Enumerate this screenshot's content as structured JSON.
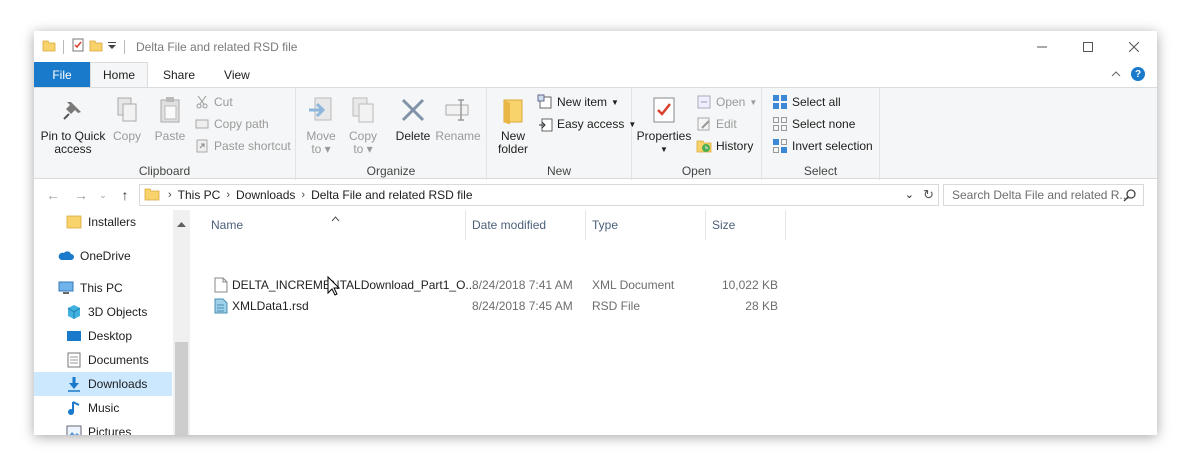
{
  "window": {
    "title": "Delta File and related RSD file"
  },
  "tabs": [
    {
      "label": "File"
    },
    {
      "label": "Home"
    },
    {
      "label": "Share"
    },
    {
      "label": "View"
    }
  ],
  "ribbon": {
    "clipboard": {
      "group_label": "Clipboard",
      "pin_label_1": "Pin to Quick",
      "pin_label_2": "access",
      "copy_label": "Copy",
      "paste_label": "Paste",
      "cut_label": "Cut",
      "copy_path_label": "Copy path",
      "paste_shortcut_label": "Paste shortcut"
    },
    "organize": {
      "group_label": "Organize",
      "move_to_1": "Move",
      "move_to_2": "to",
      "copy_to_1": "Copy",
      "copy_to_2": "to",
      "delete_label": "Delete",
      "rename_label": "Rename"
    },
    "new": {
      "group_label": "New",
      "new_folder_1": "New",
      "new_folder_2": "folder",
      "new_item_label": "New item",
      "easy_access_label": "Easy access"
    },
    "open": {
      "group_label": "Open",
      "properties_label": "Properties",
      "open_label": "Open",
      "edit_label": "Edit",
      "history_label": "History"
    },
    "select": {
      "group_label": "Select",
      "select_all_label": "Select all",
      "select_none_label": "Select none",
      "invert_label": "Invert selection"
    }
  },
  "address": {
    "crumbs": [
      "This PC",
      "Downloads",
      "Delta File and related RSD file"
    ],
    "search_placeholder": "Search Delta File and related R..."
  },
  "nav": [
    {
      "label": "Installers"
    },
    {
      "label": "OneDrive"
    },
    {
      "label": "This PC"
    },
    {
      "label": "3D Objects"
    },
    {
      "label": "Desktop"
    },
    {
      "label": "Documents"
    },
    {
      "label": "Downloads"
    },
    {
      "label": "Music"
    },
    {
      "label": "Pictures"
    }
  ],
  "columns": {
    "name": "Name",
    "date": "Date modified",
    "type": "Type",
    "size": "Size"
  },
  "files": [
    {
      "name": "DELTA_INCREMENTALDownload_Part1_O...",
      "date": "8/24/2018 7:41 AM",
      "type": "XML Document",
      "size": "10,022 KB"
    },
    {
      "name": "XMLData1.rsd",
      "date": "8/24/2018 7:45 AM",
      "type": "RSD File",
      "size": "28 KB"
    }
  ],
  "colors": {
    "accent": "#1979ca",
    "folder": "#f8d26a",
    "selection": "#cce8ff"
  }
}
